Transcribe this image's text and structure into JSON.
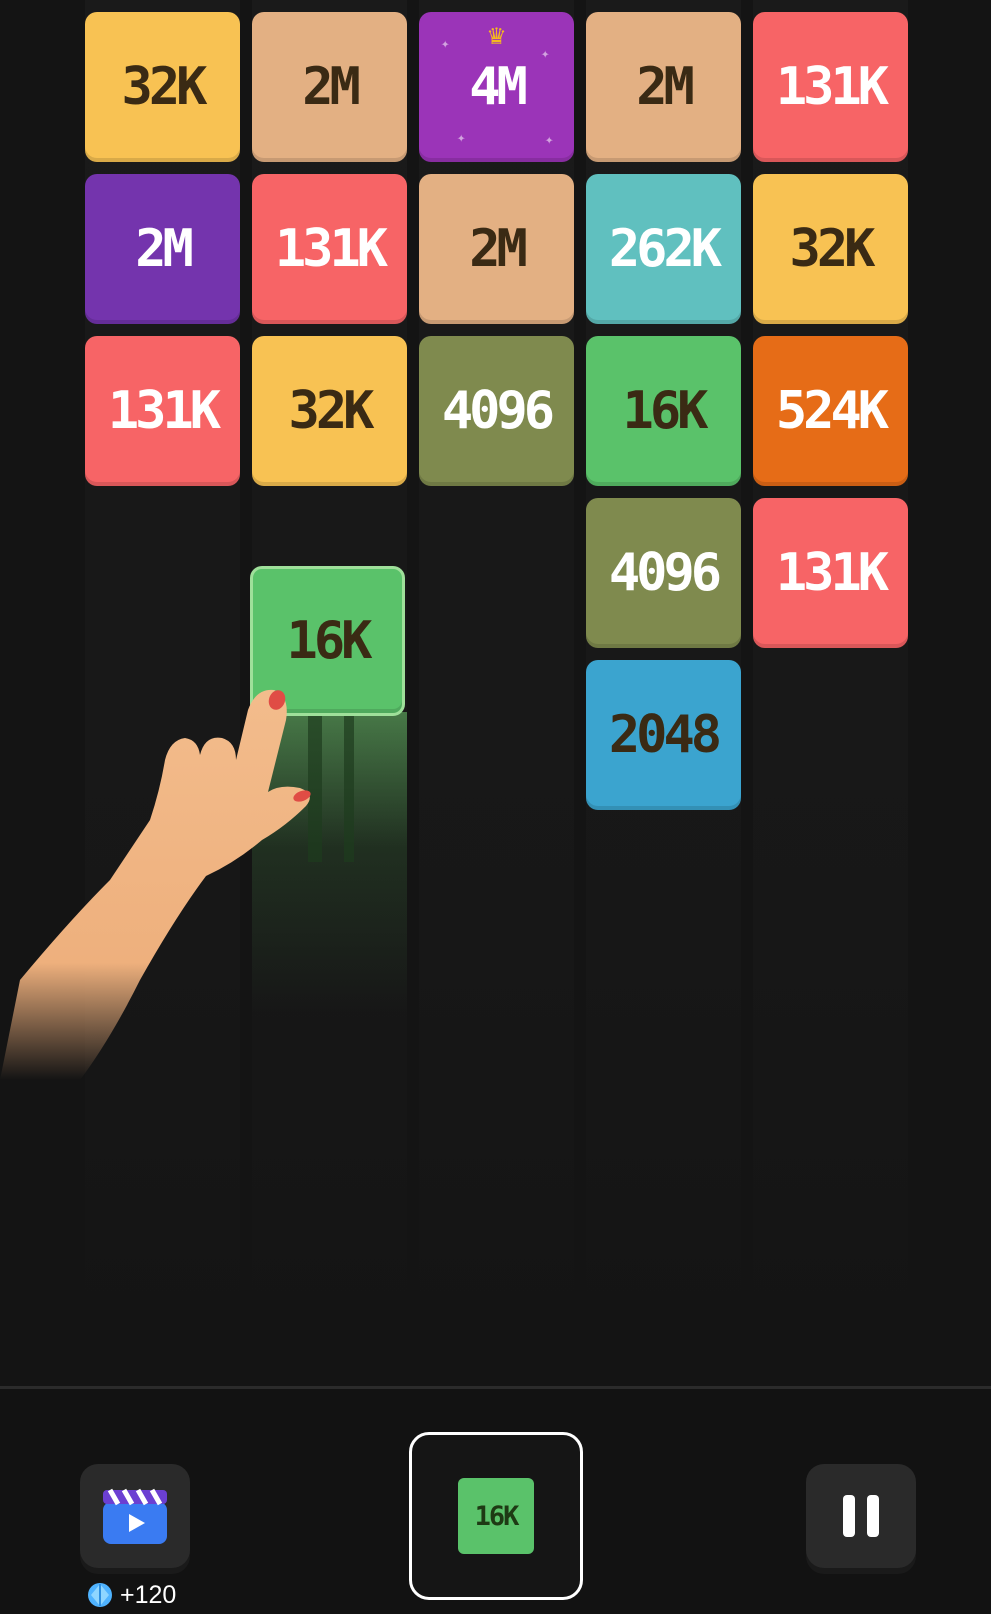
{
  "board": {
    "tiles": [
      {
        "label": "32K",
        "col": 0,
        "row": 0,
        "color": "#f8c253",
        "text": "dark"
      },
      {
        "label": "2M",
        "col": 1,
        "row": 0,
        "color": "#e3b083",
        "text": "dark"
      },
      {
        "label": "4M",
        "col": 2,
        "row": 0,
        "color": "#9b34b8",
        "text": "light",
        "crowned": true
      },
      {
        "label": "2M",
        "col": 3,
        "row": 0,
        "color": "#e3b083",
        "text": "dark"
      },
      {
        "label": "131K",
        "col": 4,
        "row": 0,
        "color": "#f76466",
        "text": "light"
      },
      {
        "label": "2M",
        "col": 0,
        "row": 1,
        "color": "#7434ad",
        "text": "light"
      },
      {
        "label": "131K",
        "col": 1,
        "row": 1,
        "color": "#f76466",
        "text": "light"
      },
      {
        "label": "2M",
        "col": 2,
        "row": 1,
        "color": "#e3b083",
        "text": "dark"
      },
      {
        "label": "262K",
        "col": 3,
        "row": 1,
        "color": "#60c0bf",
        "text": "light"
      },
      {
        "label": "32K",
        "col": 4,
        "row": 1,
        "color": "#f8c253",
        "text": "dark"
      },
      {
        "label": "131K",
        "col": 0,
        "row": 2,
        "color": "#f76466",
        "text": "light"
      },
      {
        "label": "32K",
        "col": 1,
        "row": 2,
        "color": "#f8c253",
        "text": "dark"
      },
      {
        "label": "4096",
        "col": 2,
        "row": 2,
        "color": "#7f8a4e",
        "text": "light"
      },
      {
        "label": "16K",
        "col": 3,
        "row": 2,
        "color": "#5ac26a",
        "text": "dark"
      },
      {
        "label": "524K",
        "col": 4,
        "row": 2,
        "color": "#e66c17",
        "text": "light"
      },
      {
        "label": "4096",
        "col": 3,
        "row": 3,
        "color": "#7f8a4e",
        "text": "light"
      },
      {
        "label": "131K",
        "col": 4,
        "row": 3,
        "color": "#f76466",
        "text": "light"
      },
      {
        "label": "2048",
        "col": 3,
        "row": 4,
        "color": "#3ba4cf",
        "text": "dark"
      }
    ],
    "falling_tile": {
      "label": "16K",
      "col": 1,
      "color": "#5ac26a"
    }
  },
  "footer": {
    "video_reward_label": "+120",
    "next_tile_label": "16K",
    "icons": {
      "video": "video-ad-icon",
      "gem": "gem-icon",
      "pause": "pause-icon"
    }
  }
}
